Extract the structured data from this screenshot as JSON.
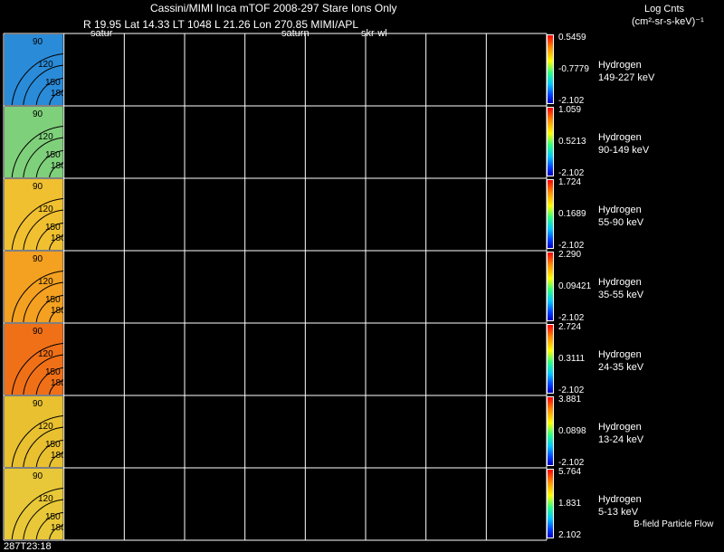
{
  "header": {
    "title": "Cassini/MIMI Inca mTOF  2008-297   Stare   Ions Only",
    "info_line": "R        19.95 Lat 14.33 LT 1048 L        21.26 Lon        270.85  MIMI/APL",
    "label_satur": "satur",
    "label_saturn": "saturn",
    "label_skr": "skr-wl",
    "units_title": "Log Cnts",
    "units_sub": "(cm²-sr-s-keV)⁻¹"
  },
  "footer": {
    "timestamp": "287T23:18",
    "note": "B-field Particle Flow"
  },
  "contour_labels": [
    "90",
    "120",
    "150",
    "180"
  ],
  "colors": {
    "background": "#000000",
    "grid": "#ffffff"
  },
  "chart_data": {
    "type": "heatmap",
    "grid": true,
    "columns": 9,
    "series": [
      {
        "name": "Hydrogen",
        "range": "149-227 keV",
        "max": "0.5459",
        "mid": "-0.7779",
        "min": "-2.102"
      },
      {
        "name": "Hydrogen",
        "range": "90-149 keV",
        "max": "1.059",
        "mid": "0.5213",
        "min": "-2.102"
      },
      {
        "name": "Hydrogen",
        "range": "55-90 keV",
        "max": "1.724",
        "mid": "0.1689",
        "min": "-2.102"
      },
      {
        "name": "Hydrogen",
        "range": "35-55 keV",
        "max": "2.290",
        "mid": "0.09421",
        "min": "-2.102"
      },
      {
        "name": "Hydrogen",
        "range": "24-35 keV",
        "max": "2.724",
        "mid": "0.3111",
        "min": "-2.102"
      },
      {
        "name": "Hydrogen",
        "range": "13-24 keV",
        "max": "3.881",
        "mid": "0.0898",
        "min": "-2.102"
      },
      {
        "name": "Hydrogen",
        "range": "5-13 keV",
        "max": "5.764",
        "mid": "1.831",
        "min": "2.102"
      }
    ]
  }
}
